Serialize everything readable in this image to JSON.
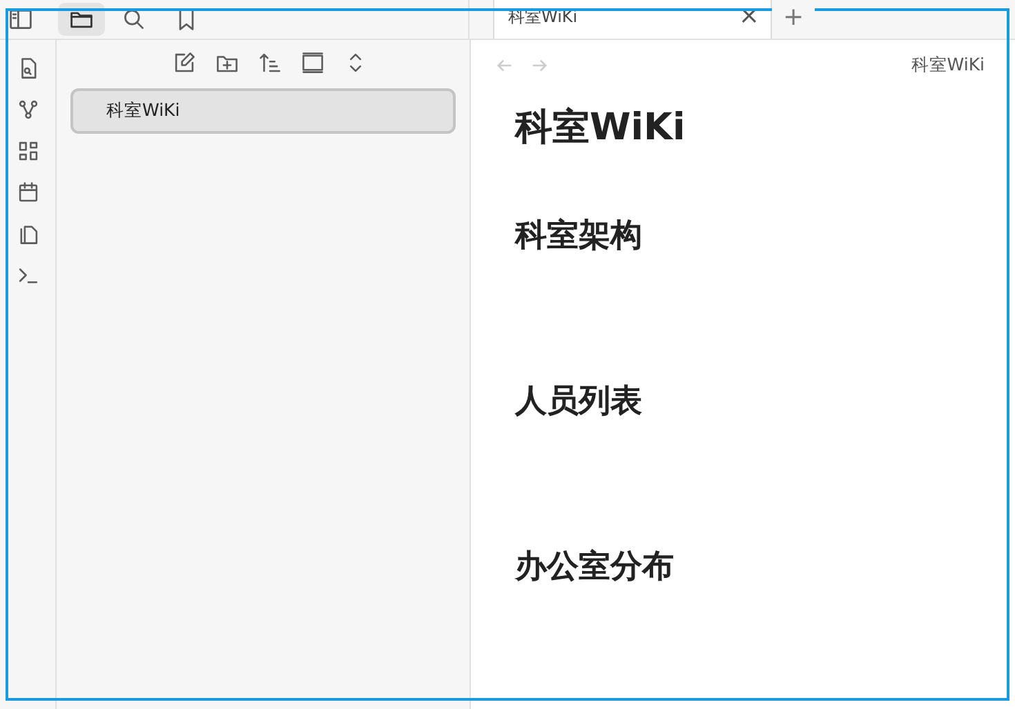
{
  "sidebar_tabs": [
    {
      "kind": "files",
      "selected": true
    },
    {
      "kind": "search",
      "selected": false
    },
    {
      "kind": "bookmarks",
      "selected": false
    }
  ],
  "ribbon": [
    {
      "kind": "quick-switch"
    },
    {
      "kind": "graph"
    },
    {
      "kind": "canvas"
    },
    {
      "kind": "calendar"
    },
    {
      "kind": "templates"
    },
    {
      "kind": "terminal"
    }
  ],
  "file_toolbar": [
    {
      "kind": "new-note"
    },
    {
      "kind": "new-folder"
    },
    {
      "kind": "sort"
    },
    {
      "kind": "collapse"
    },
    {
      "kind": "expand"
    }
  ],
  "file_tree": [
    {
      "label": "科室WiKi",
      "selected": true
    }
  ],
  "editor_tabs": [
    {
      "title": "科室WiKi",
      "selected": true,
      "close": "×"
    }
  ],
  "new_tab": "+",
  "view_header": {
    "back_disabled": true,
    "forward_disabled": true,
    "title": "科室WiKi"
  },
  "document": [
    {
      "kind": "h1",
      "text": "科室WiKi"
    },
    {
      "kind": "h2",
      "text": "科室架构"
    },
    {
      "kind": "h2",
      "text": "人员列表"
    },
    {
      "kind": "h2",
      "text": "办公室分布"
    }
  ]
}
